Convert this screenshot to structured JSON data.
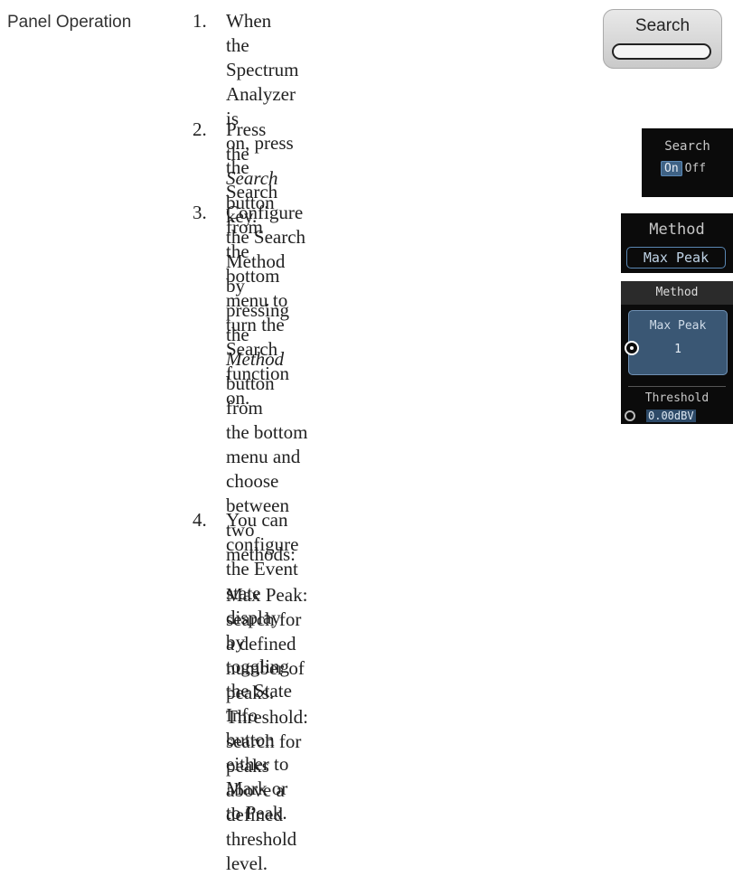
{
  "side_label": "Panel Operation",
  "steps": [
    {
      "num": "1.",
      "lines": [
        "When the Spectrum Analyzer is",
        "on, press the Search key."
      ]
    },
    {
      "num": "2.",
      "lines_html": [
        "Press the <i>Search</i> button from the",
        "bottom menu to turn the Search",
        "function on."
      ]
    },
    {
      "num": "3.",
      "lines_html": [
        "Configure the Search Method by",
        "pressing the <i>Method</i> button from",
        "the bottom menu and choose",
        "between two methods:"
      ],
      "desc": [
        "Max Peak: search for a defined",
        "number of peaks. Threshold:",
        "search for peaks above a defined",
        "threshold level."
      ]
    },
    {
      "num": "4.",
      "lines": [
        "You can configure the Event state display by",
        "toggling the State Info button either to Mark or",
        "to Peak."
      ]
    }
  ],
  "search_key": {
    "label": "Search"
  },
  "search_softkey": {
    "title": "Search",
    "on": "On",
    "off": "Off"
  },
  "method_softkey": {
    "title": "Method",
    "value": "Max Peak"
  },
  "method_menu": {
    "header": "Method",
    "option1": "Max Peak",
    "option1_value": "1",
    "option2": "Threshold",
    "option2_value": "0.00dBV"
  }
}
